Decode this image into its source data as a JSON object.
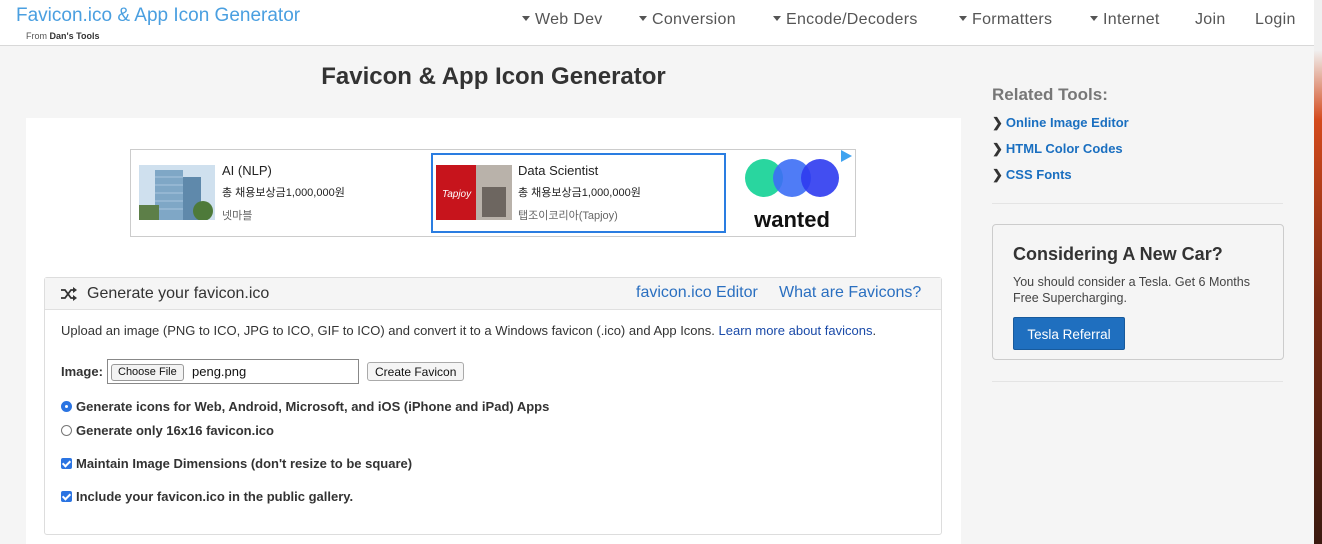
{
  "brand": {
    "title": "Favicon.ico & App Icon Generator",
    "sub_prefix": "From ",
    "sub_name": "Dan's Tools"
  },
  "nav": {
    "items": [
      {
        "label": "Web Dev",
        "dropdown": true
      },
      {
        "label": "Conversion",
        "dropdown": true
      },
      {
        "label": "Encode/Decoders",
        "dropdown": true
      },
      {
        "label": "Formatters",
        "dropdown": true
      },
      {
        "label": "Internet",
        "dropdown": true
      },
      {
        "label": "Join",
        "dropdown": false
      },
      {
        "label": "Login",
        "dropdown": false
      }
    ]
  },
  "page": {
    "title": "Favicon & App Icon Generator"
  },
  "ad": {
    "items": [
      {
        "title": "AI (NLP)",
        "subtitle": "총 채용보상금1,000,000원",
        "advertiser": "넷마블"
      },
      {
        "title": "Data Scientist",
        "subtitle": "총 채용보상금1,000,000원",
        "advertiser": "탭조이코리아(Tapjoy)"
      }
    ],
    "thumb_label": "Tapjoy",
    "brand_logo": "wanted",
    "colors": {
      "green": "#1ed49a",
      "blue": "#3c6ef5",
      "navy": "#2d3bf0",
      "highlight": "#2a7de1"
    }
  },
  "panel": {
    "title": "Generate your favicon.ico",
    "icon": "shuffle-icon",
    "links": [
      "favicon.ico Editor",
      "What are Favicons?"
    ],
    "description": "Upload an image (PNG to ICO, JPG to ICO, GIF to ICO) and convert it to a Windows favicon (.ico) and App Icons.",
    "learn_more": "Learn more about favicons",
    "image_label": "Image:",
    "choose_file": "Choose File",
    "file_name": "peng.png",
    "create_button": "Create Favicon",
    "options": [
      {
        "type": "radio",
        "label": "Generate icons for Web, Android, Microsoft, and iOS (iPhone and iPad) Apps",
        "checked": true
      },
      {
        "type": "radio",
        "label": "Generate only 16x16 favicon.ico",
        "checked": false
      },
      {
        "type": "checkbox",
        "label": "Maintain Image Dimensions (don't resize to be square)",
        "checked": true
      },
      {
        "type": "checkbox",
        "label": "Include your favicon.ico in the public gallery.",
        "checked": true
      }
    ]
  },
  "sidebar": {
    "heading": "Related Tools:",
    "links": [
      "Online Image Editor",
      "HTML Color Codes",
      "CSS Fonts"
    ],
    "promo": {
      "title": "Considering A New Car?",
      "text": "You should consider a Tesla. Get 6 Months Free Supercharging.",
      "button": "Tesla Referral"
    }
  },
  "colors": {
    "accent": "#4a9fe0",
    "link": "#2a6fc0",
    "button": "#1f6fbf"
  }
}
